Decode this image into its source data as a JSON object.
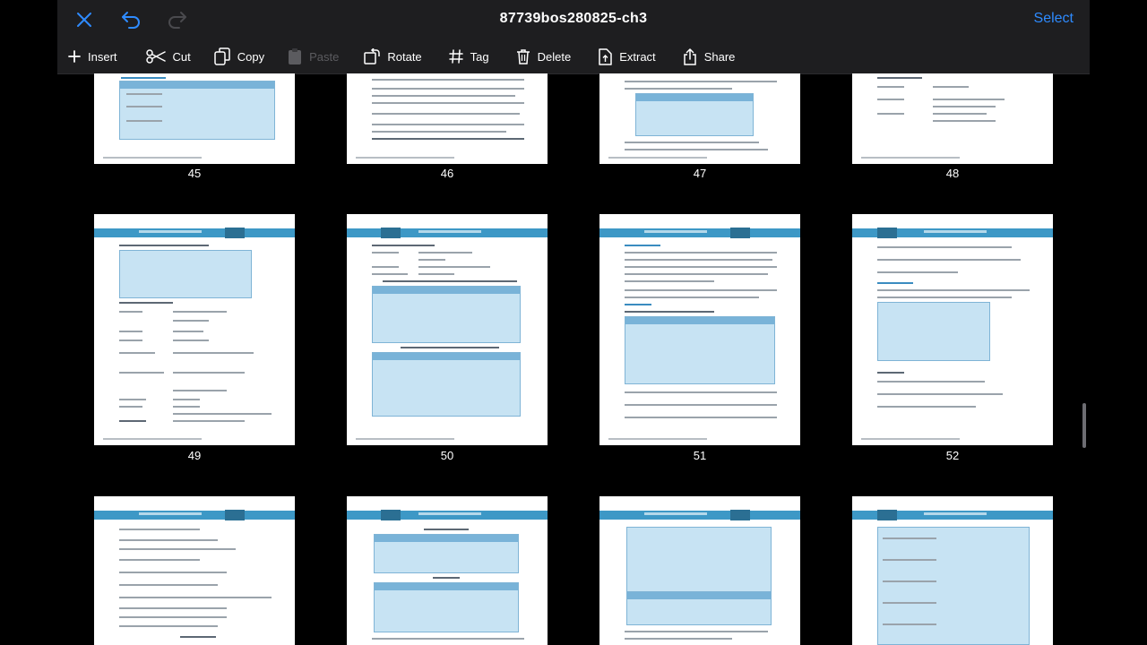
{
  "app": {
    "title": "87739bos280825-ch3",
    "select_label": "Select"
  },
  "nav_icons": [
    "close-icon",
    "undo-icon",
    "redo-icon"
  ],
  "toolbar": {
    "insert": "Insert",
    "cut": "Cut",
    "copy": "Copy",
    "paste": "Paste",
    "rotate": "Rotate",
    "tag": "Tag",
    "delete": "Delete",
    "extract": "Extract",
    "share": "Share"
  },
  "pages": [
    {
      "number": "45"
    },
    {
      "number": "46"
    },
    {
      "number": "47"
    },
    {
      "number": "48"
    },
    {
      "number": "49"
    },
    {
      "number": "50"
    },
    {
      "number": "51"
    },
    {
      "number": "52"
    },
    {
      "number": ""
    },
    {
      "number": ""
    },
    {
      "number": ""
    },
    {
      "number": ""
    }
  ],
  "colors": {
    "accent": "#2e8bff",
    "toolbar_bg": "#1e1e20",
    "page_header": "#3d98c6",
    "table_fill": "#c7e3f3"
  }
}
